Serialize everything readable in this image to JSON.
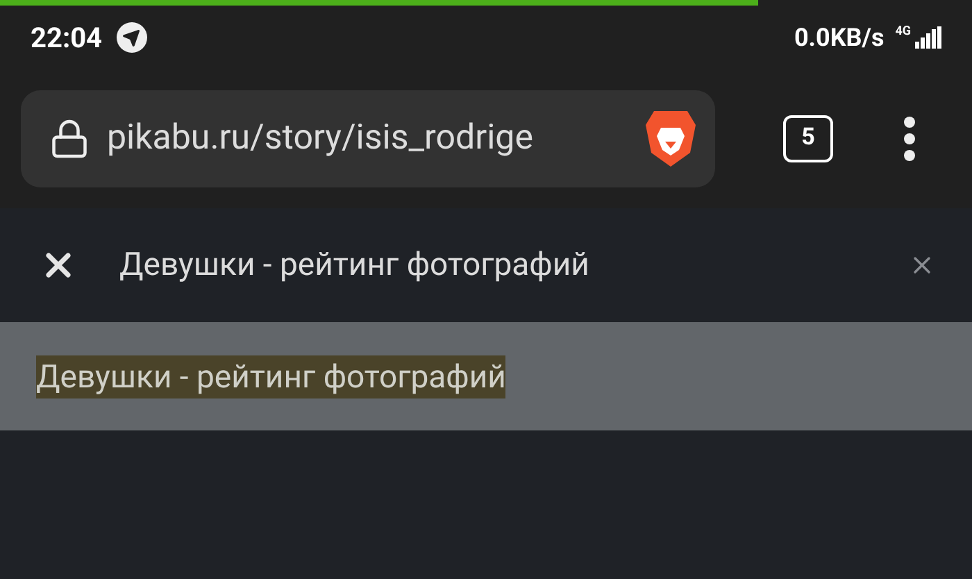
{
  "status_bar": {
    "time": "22:04",
    "network_speed": "0.0KB/s",
    "network_type": "4G"
  },
  "page_load": {
    "level": 0.78
  },
  "toolbar": {
    "url": "pikabu.ru/story/isis_rodrige",
    "tab_count": "5"
  },
  "find_bar": {
    "query": "Девушки - рейтинг фотографий"
  },
  "page": {
    "match_text": "Девушки - рейтинг фотографий",
    "match_highlighted": true
  }
}
